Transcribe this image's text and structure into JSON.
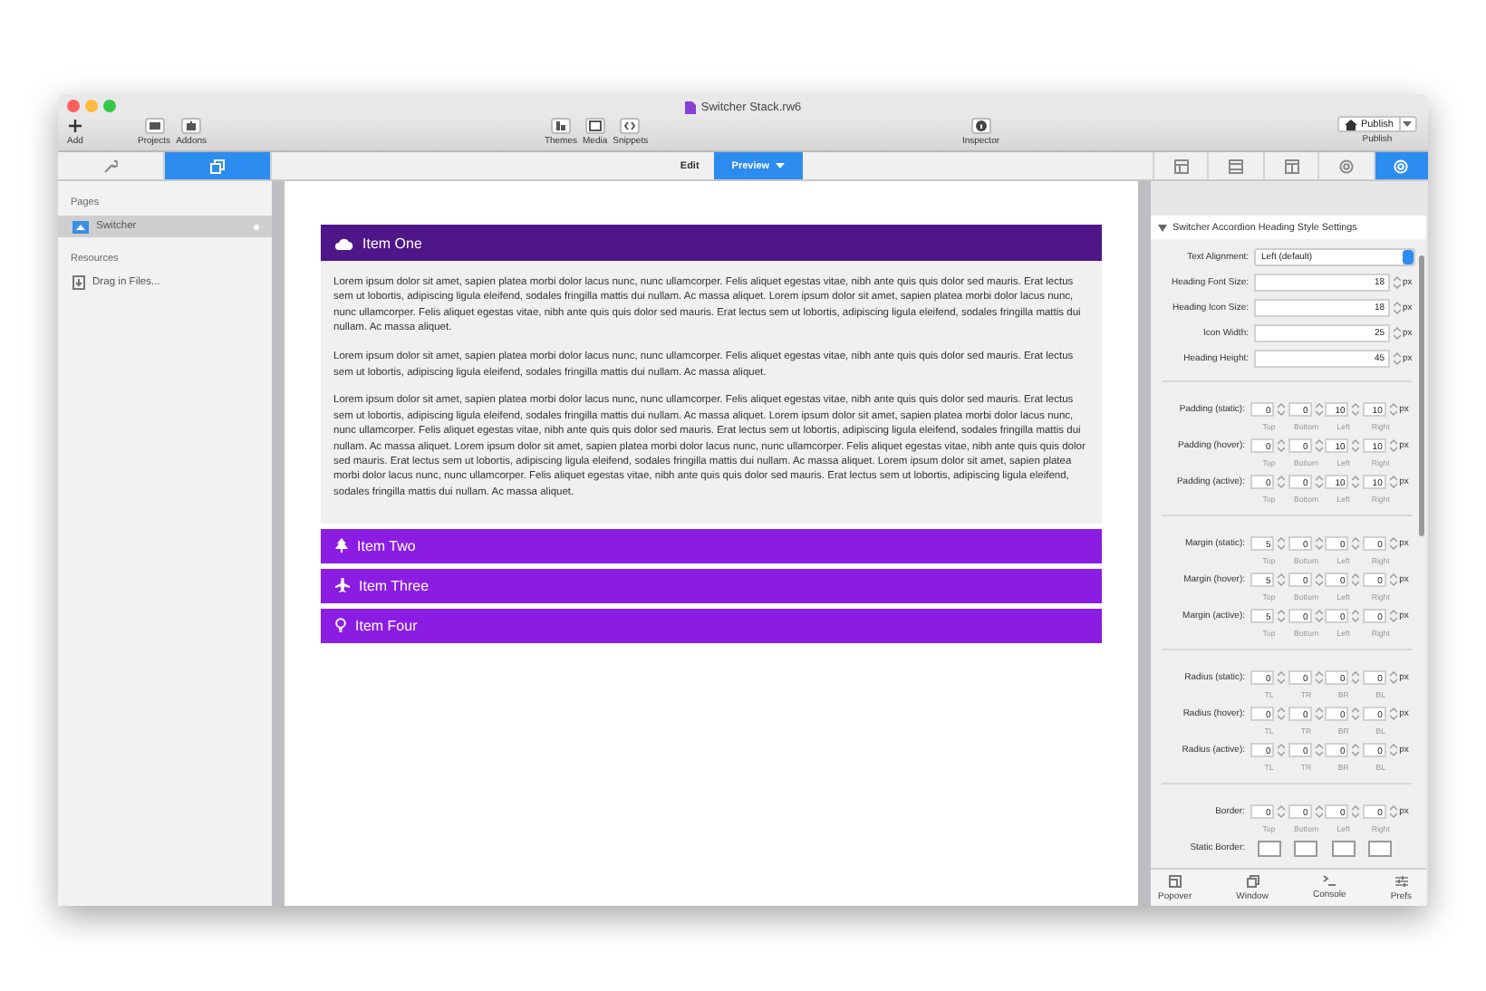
{
  "window": {
    "title": "Switcher Stack.rw6"
  },
  "toolbar": {
    "items": [
      {
        "label": "Add"
      },
      {
        "label": "Projects"
      },
      {
        "label": "Addons"
      },
      {
        "label": "Themes"
      },
      {
        "label": "Media"
      },
      {
        "label": "Snippets"
      },
      {
        "label": "Inspector"
      }
    ],
    "publish": {
      "button": "Publish",
      "label": "Publish"
    }
  },
  "left_tabs": [
    {
      "selected": false
    },
    {
      "selected": true
    }
  ],
  "mode_tabs": [
    {
      "label": "Edit",
      "selected": false
    },
    {
      "label": "Preview",
      "selected": true
    }
  ],
  "inspector_tabs": [
    {
      "selected": false
    },
    {
      "selected": false
    },
    {
      "selected": false
    },
    {
      "selected": false
    },
    {
      "selected": true
    }
  ],
  "sidebar": {
    "sections": [
      {
        "title": "Pages",
        "items": [
          {
            "label": "Switcher",
            "selected": true
          }
        ]
      },
      {
        "title": "Resources",
        "items": [
          {
            "label": "Drag in Files...",
            "selected": false
          }
        ]
      }
    ]
  },
  "accordion": [
    {
      "title": "Item One",
      "expanded": true,
      "paragraphs": [
        "Lorem ipsum dolor sit amet, sapien platea morbi dolor lacus nunc, nunc ullamcorper. Felis aliquet egestas vitae, nibh ante quis quis dolor sed mauris. Erat lectus sem ut lobortis, adipiscing ligula eleifend, sodales fringilla mattis dui nullam. Ac massa aliquet. Lorem ipsum dolor sit amet, sapien platea morbi dolor lacus nunc, nunc ullamcorper. Felis aliquet egestas vitae, nibh ante quis quis dolor sed mauris. Erat lectus sem ut lobortis, adipiscing ligula eleifend, sodales fringilla mattis dui nullam. Ac massa aliquet.",
        "Lorem ipsum dolor sit amet, sapien platea morbi dolor lacus nunc, nunc ullamcorper. Felis aliquet egestas vitae, nibh ante quis quis dolor sed mauris. Erat lectus sem ut lobortis, adipiscing ligula eleifend, sodales fringilla mattis dui nullam. Ac massa aliquet.",
        "Lorem ipsum dolor sit amet, sapien platea morbi dolor lacus nunc, nunc ullamcorper. Felis aliquet egestas vitae, nibh ante quis quis dolor sed mauris. Erat lectus sem ut lobortis, adipiscing ligula eleifend, sodales fringilla mattis dui nullam. Ac massa aliquet. Lorem ipsum dolor sit amet, sapien platea morbi dolor lacus nunc, nunc ullamcorper. Felis aliquet egestas vitae, nibh ante quis quis dolor sed mauris. Erat lectus sem ut lobortis, adipiscing ligula eleifend, sodales fringilla mattis dui nullam. Ac massa aliquet. Lorem ipsum dolor sit amet, sapien platea morbi dolor lacus nunc, nunc ullamcorper. Felis aliquet egestas vitae, nibh ante quis quis dolor sed mauris. Erat lectus sem ut lobortis, adipiscing ligula eleifend, sodales fringilla mattis dui nullam. Ac massa aliquet. Lorem ipsum dolor sit amet, sapien platea morbi dolor lacus nunc, nunc ullamcorper. Felis aliquet egestas vitae, nibh ante quis quis dolor sed mauris. Erat lectus sem ut lobortis, adipiscing ligula eleifend, sodales fringilla mattis dui nullam. Ac massa aliquet."
      ]
    },
    {
      "title": "Item Two",
      "expanded": false
    },
    {
      "title": "Item Three",
      "expanded": false
    },
    {
      "title": "Item Four",
      "expanded": false
    }
  ],
  "inspector": {
    "title": "Switcher Accordion Heading Style Settings",
    "expanded": true,
    "groups": [
      [
        {
          "kind": "select",
          "label": "Text Alignment:",
          "value": "Left (default)"
        },
        {
          "kind": "number",
          "label": "Heading Font Size:",
          "value": "18",
          "unit": "px"
        },
        {
          "kind": "number",
          "label": "Heading Icon Size:",
          "value": "18",
          "unit": "px"
        },
        {
          "kind": "number",
          "label": "Icon Width:",
          "value": "25",
          "unit": "px"
        },
        {
          "kind": "number",
          "label": "Heading Height:",
          "value": "45",
          "unit": "px"
        }
      ],
      [
        {
          "kind": "quad",
          "label": "Padding (static):",
          "values": [
            "0",
            "0",
            "10",
            "10"
          ],
          "sublabels": [
            "Top",
            "Bottom",
            "Left",
            "Right"
          ],
          "unit": "px"
        },
        {
          "kind": "quad",
          "label": "Padding (hover):",
          "values": [
            "0",
            "0",
            "10",
            "10"
          ],
          "sublabels": [
            "Top",
            "Bottom",
            "Left",
            "Right"
          ],
          "unit": "px"
        },
        {
          "kind": "quad",
          "label": "Padding (active):",
          "values": [
            "0",
            "0",
            "10",
            "10"
          ],
          "sublabels": [
            "Top",
            "Bottom",
            "Left",
            "Right"
          ],
          "unit": "px"
        }
      ],
      [
        {
          "kind": "quad",
          "label": "Margin (static):",
          "values": [
            "5",
            "0",
            "0",
            "0"
          ],
          "sublabels": [
            "Top",
            "Bottom",
            "Left",
            "Right"
          ],
          "unit": "px"
        },
        {
          "kind": "quad",
          "label": "Margin (hover):",
          "values": [
            "5",
            "0",
            "0",
            "0"
          ],
          "sublabels": [
            "Top",
            "Bottom",
            "Left",
            "Right"
          ],
          "unit": "px"
        },
        {
          "kind": "quad",
          "label": "Margin (active):",
          "values": [
            "5",
            "0",
            "0",
            "0"
          ],
          "sublabels": [
            "Top",
            "Bottom",
            "Left",
            "Right"
          ],
          "unit": "px"
        }
      ],
      [
        {
          "kind": "quad",
          "label": "Radius (static):",
          "values": [
            "0",
            "0",
            "0",
            "0"
          ],
          "sublabels": [
            "TL",
            "TR",
            "BR",
            "BL"
          ],
          "unit": "px"
        },
        {
          "kind": "quad",
          "label": "Radius (hover):",
          "values": [
            "0",
            "0",
            "0",
            "0"
          ],
          "sublabels": [
            "TL",
            "TR",
            "BR",
            "BL"
          ],
          "unit": "px"
        },
        {
          "kind": "quad",
          "label": "Radius (active):",
          "values": [
            "0",
            "0",
            "0",
            "0"
          ],
          "sublabels": [
            "TL",
            "TR",
            "BR",
            "BL"
          ],
          "unit": "px"
        }
      ],
      [
        {
          "kind": "quad",
          "label": "Border:",
          "values": [
            "0",
            "0",
            "0",
            "0"
          ],
          "sublabels": [
            "Top",
            "Bottom",
            "Left",
            "Right"
          ],
          "unit": "px"
        },
        {
          "kind": "swatches",
          "label": "Static Border:"
        }
      ]
    ]
  },
  "bottom_bar": [
    {
      "label": "Popover"
    },
    {
      "label": "Window"
    },
    {
      "label": "Console"
    },
    {
      "label": "Prefs"
    }
  ]
}
